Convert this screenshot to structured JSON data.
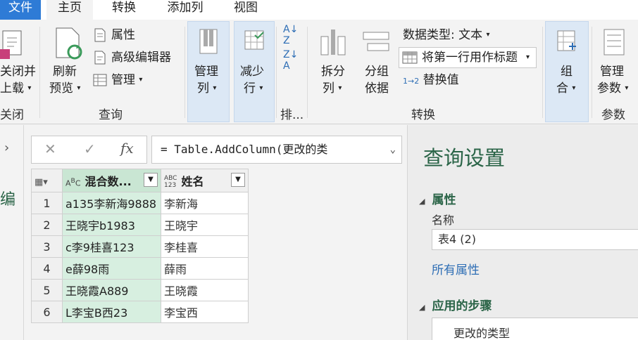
{
  "tabs": {
    "file": "文件",
    "home": "主页",
    "transform": "转换",
    "add_column": "添加列",
    "view": "视图"
  },
  "ribbon": {
    "close_load_1": "关闭并",
    "close_load_2": "上载",
    "close_group": "关闭",
    "refresh_1": "刷新",
    "refresh_2": "预览",
    "properties": "属性",
    "advanced_editor": "高级编辑器",
    "manage": "管理",
    "query_group": "查询",
    "manage_cols_1": "管理",
    "manage_cols_2": "列",
    "reduce_rows_1": "减少",
    "reduce_rows_2": "行",
    "sort_group": "排...",
    "split_col_1": "拆分",
    "split_col_2": "列",
    "group_by_1": "分组",
    "group_by_2": "依据",
    "data_type": "数据类型: 文本",
    "first_row_header": "将第一行用作标题",
    "replace_values": "替换值",
    "transform_group": "转换",
    "combine_1": "组",
    "combine_2": "合",
    "params_1": "管理",
    "params_2": "参数",
    "params_group": "参数"
  },
  "formula": {
    "text": "= Table.AddColumn(更改的类"
  },
  "grid": {
    "col1_header": "混合数...",
    "col2_header": "姓名",
    "rows": [
      {
        "n": "1",
        "mixed": "a135李新海9888",
        "name": "李新海"
      },
      {
        "n": "2",
        "mixed": "王晓宇b1983",
        "name": "王晓宇"
      },
      {
        "n": "3",
        "mixed": "c李9桂喜123",
        "name": "李桂喜"
      },
      {
        "n": "4",
        "mixed": "e薛98雨",
        "name": "薛雨"
      },
      {
        "n": "5",
        "mixed": "王晓霞A889",
        "name": "王晓霞"
      },
      {
        "n": "6",
        "mixed": "L李宝B西23",
        "name": "李宝西"
      }
    ]
  },
  "pane": {
    "title": "查询设置",
    "properties_section": "属性",
    "name_label": "名称",
    "name_value": "表4 (2)",
    "all_properties": "所有属性",
    "applied_steps": "应用的步骤",
    "step_1": "更改的类型"
  },
  "leftnav": {
    "vertical_label": "编"
  },
  "colors": {
    "accent": "#2e7bd6",
    "pane_green": "#2a6447",
    "column_highlight": "#d7efe0"
  }
}
